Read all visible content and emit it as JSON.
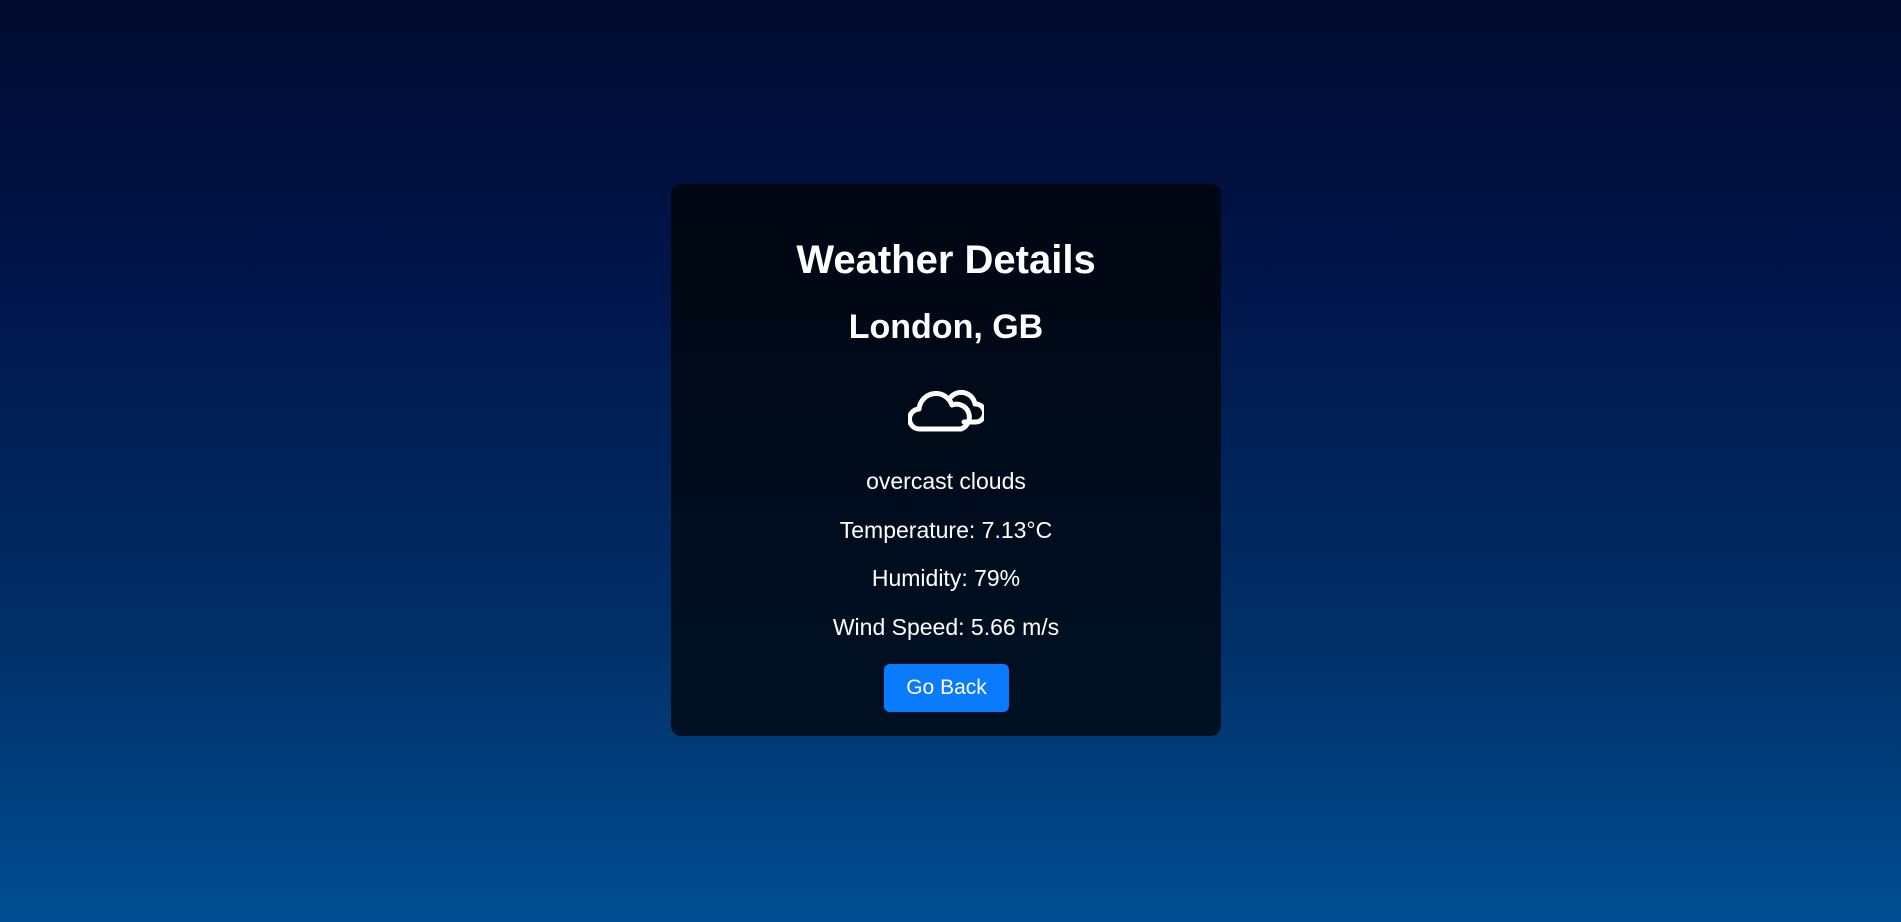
{
  "card": {
    "title": "Weather Details",
    "location": "London, GB",
    "icon": "cloud-icon",
    "description": "overcast clouds",
    "temperature": "Temperature: 7.13°C",
    "humidity": "Humidity: 79%",
    "wind_speed": "Wind Speed: 5.66 m/s",
    "go_back_label": "Go Back"
  },
  "colors": {
    "background_top": "#010a2e",
    "background_bottom": "#004e92",
    "card_background": "#000a1a",
    "button": "#0a7bff",
    "text": "#ffffff"
  }
}
